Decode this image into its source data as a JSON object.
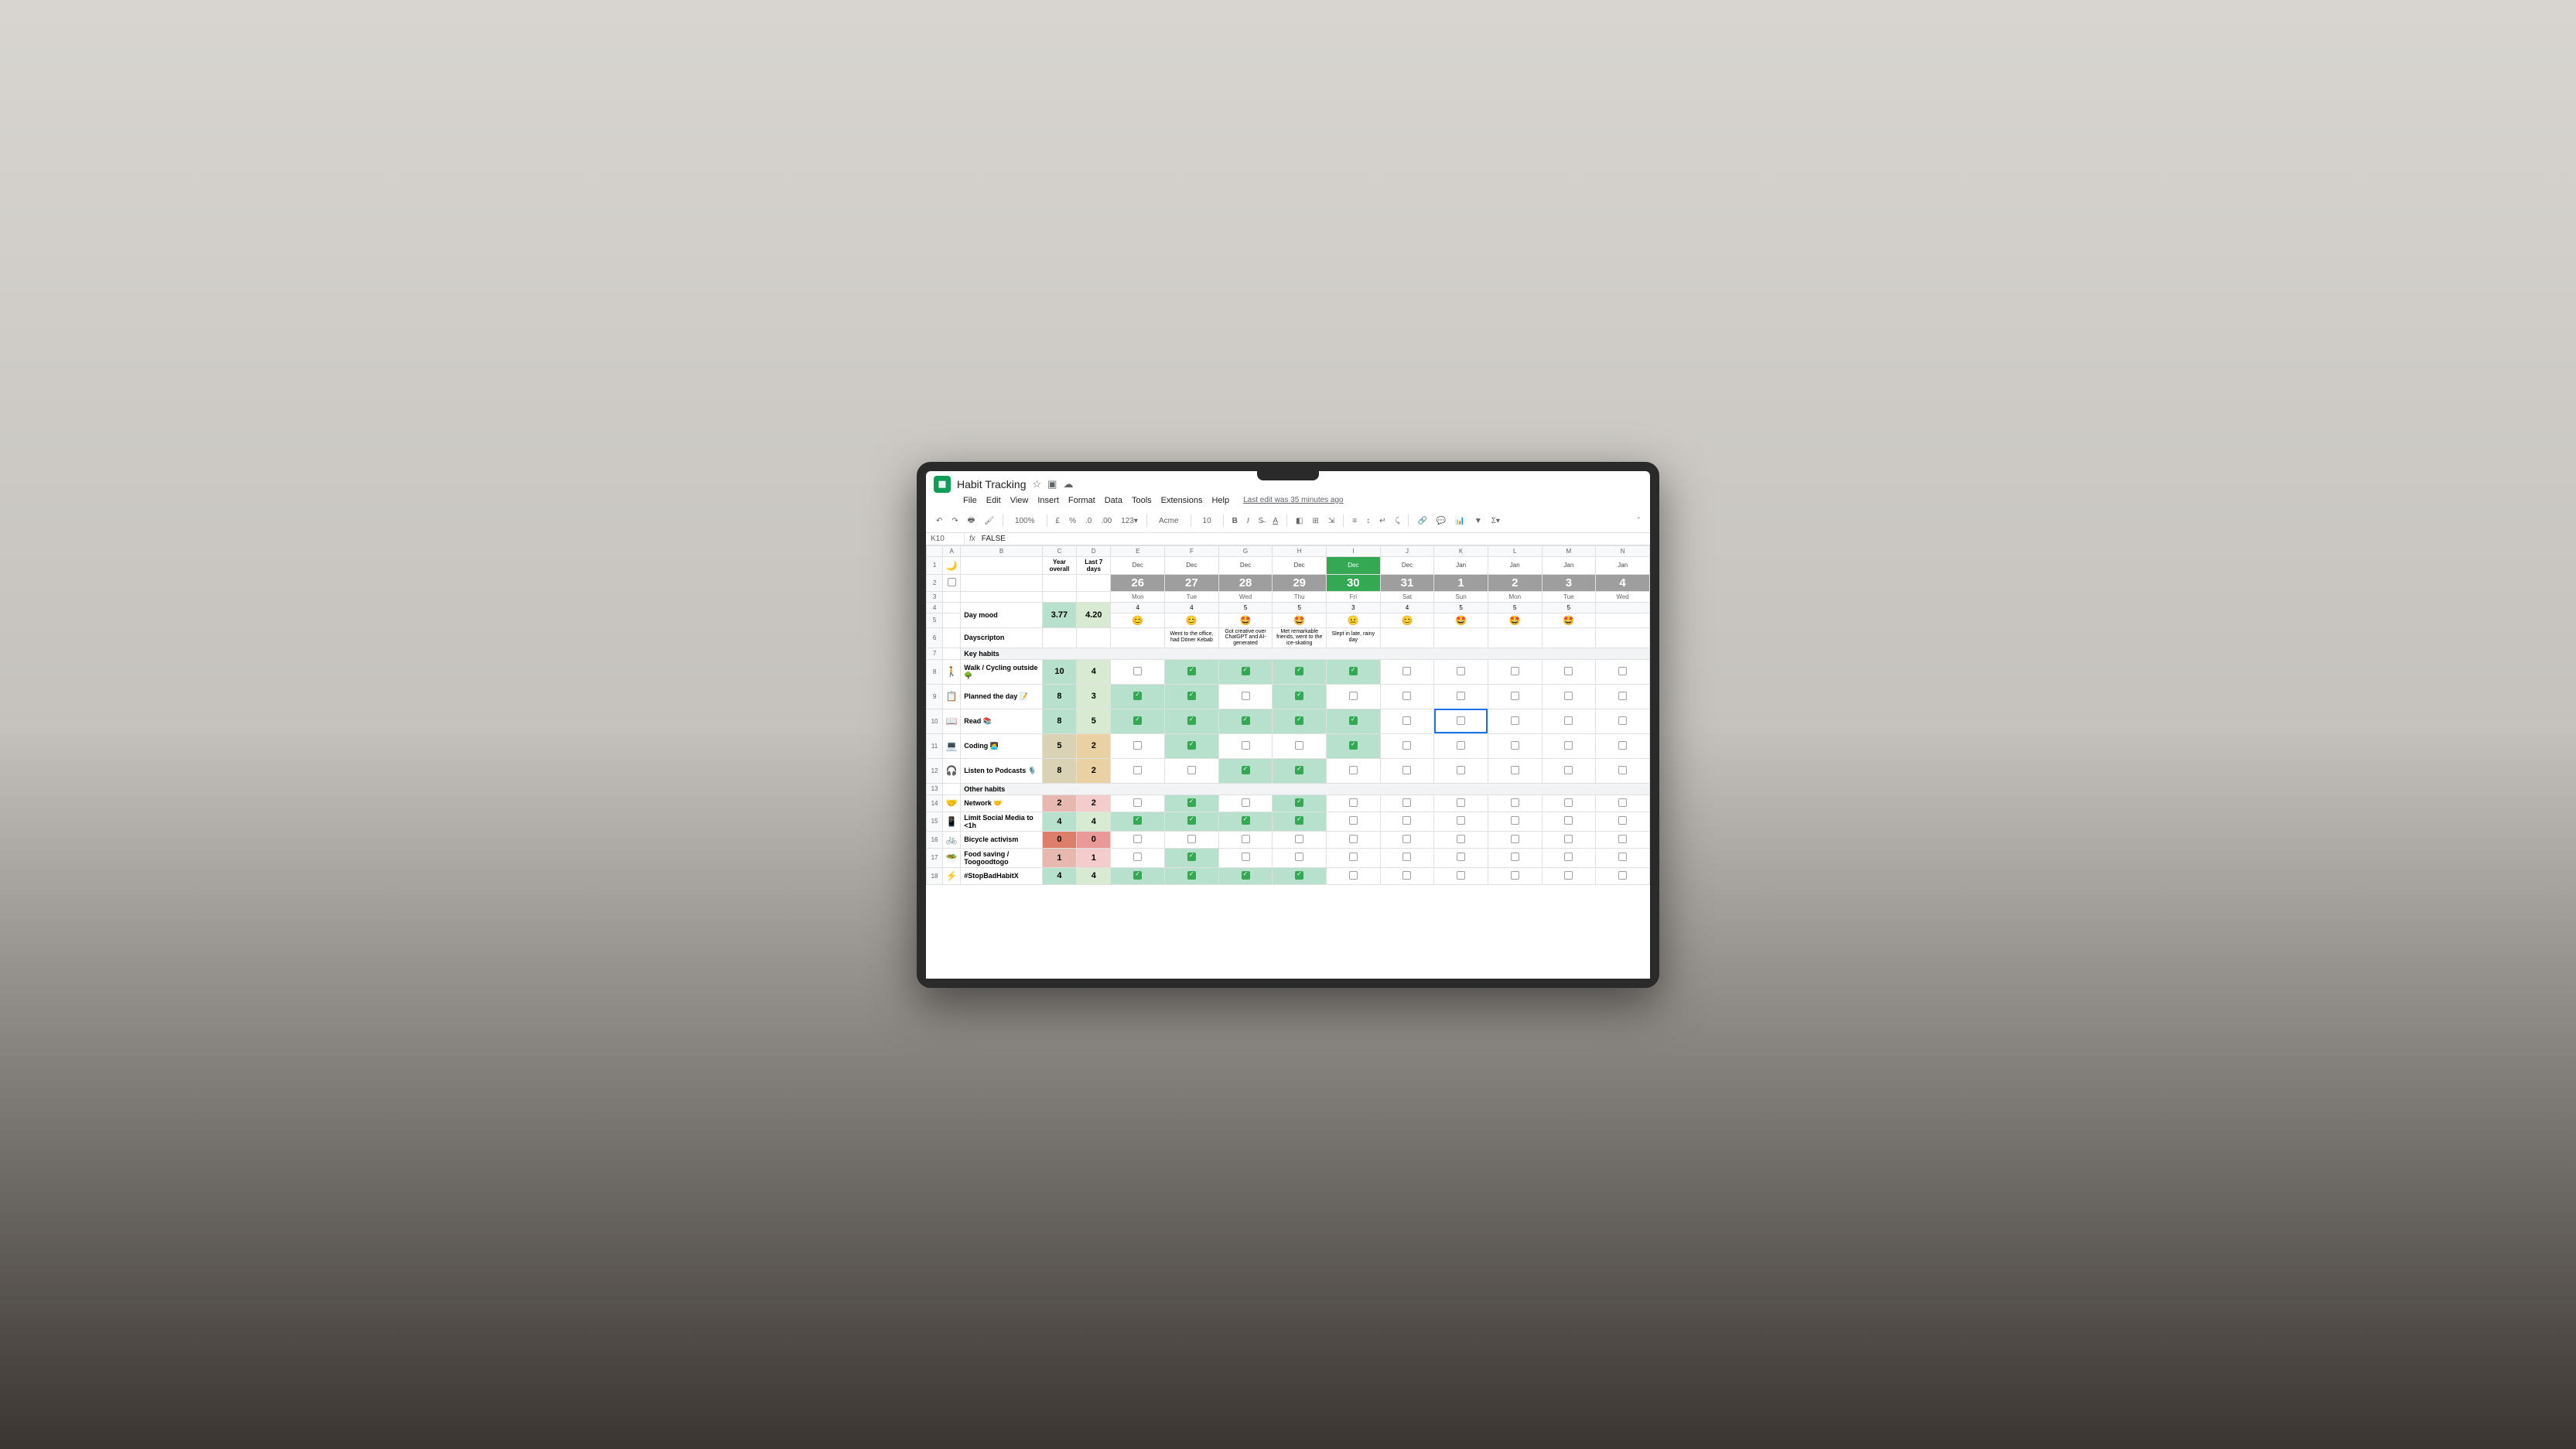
{
  "doc": {
    "title": "Habit Tracking",
    "last_edit": "Last edit was 35 minutes ago"
  },
  "menu": [
    "File",
    "Edit",
    "View",
    "Insert",
    "Format",
    "Data",
    "Tools",
    "Extensions",
    "Help"
  ],
  "toolbar": {
    "zoom": "100%",
    "currency": "£",
    "font": "Acme",
    "size": "10"
  },
  "formula": {
    "cell": "K10",
    "value": "FALSE"
  },
  "col_letters": [
    "",
    "A",
    "B",
    "C",
    "D",
    "E",
    "F",
    "G",
    "H",
    "I",
    "J",
    "K",
    "L",
    "M",
    "N"
  ],
  "summary_headers": {
    "year": "Year overall",
    "week": "Last 7 days"
  },
  "dates": [
    {
      "m": "Dec",
      "d": "26",
      "dow": "Mon",
      "hl": false
    },
    {
      "m": "Dec",
      "d": "27",
      "dow": "Tue",
      "hl": false
    },
    {
      "m": "Dec",
      "d": "28",
      "dow": "Wed",
      "hl": false
    },
    {
      "m": "Dec",
      "d": "29",
      "dow": "Thu",
      "hl": false
    },
    {
      "m": "Dec",
      "d": "30",
      "dow": "Fri",
      "hl": true
    },
    {
      "m": "Dec",
      "d": "31",
      "dow": "Sat",
      "hl": false
    },
    {
      "m": "Jan",
      "d": "1",
      "dow": "Sun",
      "hl": false
    },
    {
      "m": "Jan",
      "d": "2",
      "dow": "Mon",
      "hl": false
    },
    {
      "m": "Jan",
      "d": "3",
      "dow": "Tue",
      "hl": false
    },
    {
      "m": "Jan",
      "d": "4",
      "dow": "Wed",
      "hl": false
    }
  ],
  "mood": {
    "label": "Day mood",
    "year": "3.77",
    "week": "4.20",
    "ratings": [
      "4",
      "4",
      "5",
      "5",
      "3",
      "4",
      "5",
      "5",
      "5",
      ""
    ],
    "emojis": [
      "😊",
      "😊",
      "🤩",
      "🤩",
      "😐",
      "😊",
      "🤩",
      "🤩",
      "🤩",
      ""
    ]
  },
  "descripton": {
    "label": "Dayscripton",
    "values": [
      "",
      "Went to the office, had Döner Kebab",
      "Got creative over ChatGPT and AI-generated",
      "Met remarkable friends, went to the ice-skating",
      "Slept in late, rainy day",
      "",
      "",
      "",
      "",
      ""
    ]
  },
  "sections": [
    {
      "title": "Key habits"
    },
    {
      "title": "Other habits"
    }
  ],
  "rows": [
    {
      "icon": "🚶",
      "label": "Walk / Cycling outside 🌳",
      "y": "10",
      "w": "4",
      "cls": "",
      "checks": [
        0,
        1,
        1,
        1,
        1,
        0,
        0,
        0,
        0,
        0
      ]
    },
    {
      "icon": "📋",
      "label": "Planned the day 📝",
      "y": "8",
      "w": "3",
      "cls": "",
      "checks": [
        1,
        1,
        0,
        1,
        0,
        0,
        0,
        0,
        0,
        0
      ]
    },
    {
      "icon": "📖",
      "label": "Read 📚",
      "y": "8",
      "w": "5",
      "cls": "",
      "checks": [
        1,
        1,
        1,
        1,
        1,
        0,
        0,
        0,
        0,
        0
      ],
      "sel": 6
    },
    {
      "icon": "💻",
      "label": "Coding 🧑‍💻",
      "y": "5",
      "w": "2",
      "cls": "med",
      "checks": [
        0,
        1,
        0,
        0,
        1,
        0,
        0,
        0,
        0,
        0
      ]
    },
    {
      "icon": "🎧",
      "label": "Listen to Podcasts 🎙️",
      "y": "8",
      "w": "2",
      "cls": "med",
      "checks": [
        0,
        0,
        1,
        1,
        0,
        0,
        0,
        0,
        0,
        0
      ]
    }
  ],
  "rows2": [
    {
      "icon": "🤝",
      "label": "Network 🤝",
      "y": "2",
      "w": "2",
      "cls": "low",
      "checks": [
        0,
        1,
        0,
        1,
        0,
        0,
        0,
        0,
        0,
        0
      ]
    },
    {
      "icon": "📱",
      "label": "Limit Social Media to <1h",
      "y": "4",
      "w": "4",
      "cls": "",
      "checks": [
        1,
        1,
        1,
        1,
        0,
        0,
        0,
        0,
        0,
        0
      ]
    },
    {
      "icon": "🚲",
      "label": "Bicycle activism",
      "y": "0",
      "w": "0",
      "cls": "zero",
      "checks": [
        0,
        0,
        0,
        0,
        0,
        0,
        0,
        0,
        0,
        0
      ]
    },
    {
      "icon": "🥗",
      "label": "Food saving / Toogoodtogo",
      "y": "1",
      "w": "1",
      "cls": "low",
      "checks": [
        0,
        1,
        0,
        0,
        0,
        0,
        0,
        0,
        0,
        0
      ]
    },
    {
      "icon": "⚡",
      "label": "#StopBadHabitX",
      "y": "4",
      "w": "4",
      "cls": "",
      "checks": [
        1,
        1,
        1,
        1,
        0,
        0,
        0,
        0,
        0,
        0
      ]
    }
  ],
  "chart_data": {
    "type": "table",
    "title": "Habit Tracking",
    "categories": [
      "Dec 26",
      "Dec 27",
      "Dec 28",
      "Dec 29",
      "Dec 30",
      "Dec 31",
      "Jan 1",
      "Jan 2",
      "Jan 3",
      "Jan 4"
    ],
    "series": [
      {
        "name": "Day mood",
        "values": [
          4,
          4,
          5,
          5,
          3,
          4,
          5,
          5,
          5,
          null
        ]
      },
      {
        "name": "Walk / Cycling outside",
        "values": [
          0,
          1,
          1,
          1,
          1,
          0,
          0,
          0,
          0,
          0
        ]
      },
      {
        "name": "Planned the day",
        "values": [
          1,
          1,
          0,
          1,
          0,
          0,
          0,
          0,
          0,
          0
        ]
      },
      {
        "name": "Read",
        "values": [
          1,
          1,
          1,
          1,
          1,
          0,
          0,
          0,
          0,
          0
        ]
      },
      {
        "name": "Coding",
        "values": [
          0,
          1,
          0,
          0,
          1,
          0,
          0,
          0,
          0,
          0
        ]
      },
      {
        "name": "Listen to Podcasts",
        "values": [
          0,
          0,
          1,
          1,
          0,
          0,
          0,
          0,
          0,
          0
        ]
      },
      {
        "name": "Network",
        "values": [
          0,
          1,
          0,
          1,
          0,
          0,
          0,
          0,
          0,
          0
        ]
      },
      {
        "name": "Limit Social Media to <1h",
        "values": [
          1,
          1,
          1,
          1,
          0,
          0,
          0,
          0,
          0,
          0
        ]
      },
      {
        "name": "Bicycle activism",
        "values": [
          0,
          0,
          0,
          0,
          0,
          0,
          0,
          0,
          0,
          0
        ]
      },
      {
        "name": "Food saving / Toogoodtogo",
        "values": [
          0,
          1,
          0,
          0,
          0,
          0,
          0,
          0,
          0,
          0
        ]
      },
      {
        "name": "#StopBadHabitX",
        "values": [
          1,
          1,
          1,
          1,
          0,
          0,
          0,
          0,
          0,
          0
        ]
      }
    ]
  }
}
